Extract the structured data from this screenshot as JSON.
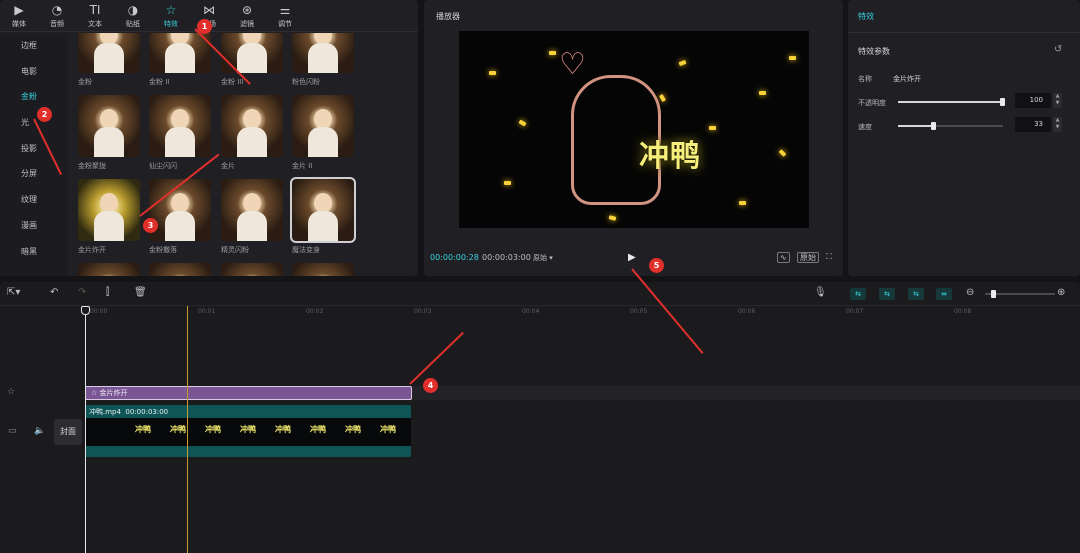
{
  "top_tabs": [
    {
      "label": "媒体",
      "icon": "media-icon"
    },
    {
      "label": "音频",
      "icon": "audio-icon"
    },
    {
      "label": "文本",
      "icon": "text-icon"
    },
    {
      "label": "贴纸",
      "icon": "sticker-icon"
    },
    {
      "label": "特效",
      "icon": "effects-icon",
      "active": true
    },
    {
      "label": "转场",
      "icon": "transition-icon"
    },
    {
      "label": "滤镜",
      "icon": "filter-icon"
    },
    {
      "label": "调节",
      "icon": "adjust-icon"
    }
  ],
  "sidebar": [
    "边框",
    "电影",
    "金粉",
    "光",
    "投影",
    "分屏",
    "纹理",
    "漫画",
    "暗黑"
  ],
  "sidebar_active": "金粉",
  "effects": [
    "金粉",
    "金粉 II",
    "金粉 III",
    "粉色闪粉",
    "金粉聚拢",
    "仙尘闪闪",
    "金片",
    "金片 II",
    "金片炸开",
    "金粉撒落",
    "精灵闪粉",
    "魔法变身"
  ],
  "annotations": [
    "1",
    "2",
    "3",
    "4",
    "5"
  ],
  "player": {
    "title": "播放器",
    "current_time": "00:00:00:28",
    "total_time": "00:00:03:00",
    "ratio_label": "原始",
    "overlay_text": "冲鸭",
    "original_button": "原始"
  },
  "properties": {
    "title": "特效",
    "section": "特效参数",
    "name_label": "名称",
    "name_value": "金片炸开",
    "opacity_label": "不透明度",
    "opacity_value": "100",
    "speed_label": "速度",
    "speed_value": "33"
  },
  "timeline": {
    "ruler": [
      "00:00",
      "00:01",
      "00:02",
      "00:03",
      "00:04",
      "00:05",
      "00:06",
      "00:07",
      "00:08"
    ],
    "effect_clip_label": "金片炸开",
    "video_clip_name": "冲鸭.mp4",
    "video_clip_duration": "00:00:03:00",
    "cover_label": "封面",
    "frame_text": "冲鸭"
  },
  "colors": {
    "accent": "#37d1dd",
    "annotation": "#e12f2b",
    "effect_clip": "#7a5694",
    "video_clip": "#0f5558"
  }
}
